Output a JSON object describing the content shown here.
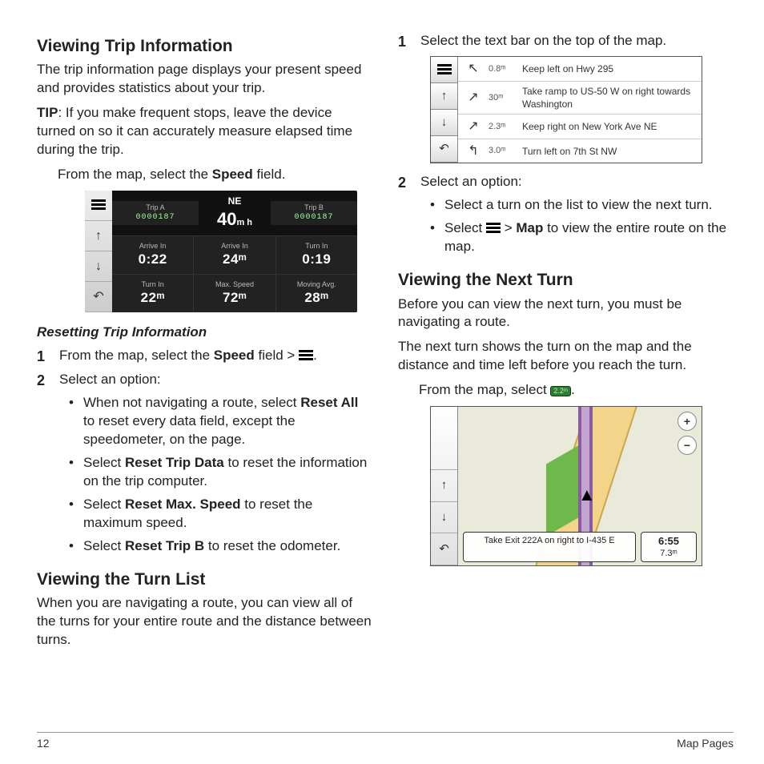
{
  "left": {
    "h1": "Viewing Trip Information",
    "p1": "The trip information page displays your present speed and provides statistics about your trip.",
    "tip_label": "TIP",
    "tip_text": ": If you make frequent stops, leave the device turned on so it can accurately measure elapsed time during the trip.",
    "from_map_pre": "From the map, select the ",
    "speed_word": "Speed",
    "from_map_post": " field.",
    "trip_fig": {
      "direction": "NE",
      "speed": "40",
      "speed_unit": "m h",
      "tripA_lbl": "Trip A",
      "tripA_val": "0000187",
      "tripB_lbl": "Trip B",
      "tripB_val": "0000187",
      "r1": [
        {
          "lbl": "Arrive In",
          "val": "0:22"
        },
        {
          "lbl": "Arrive In",
          "val": "24ᵐ"
        },
        {
          "lbl": "Turn In",
          "val": "0:19"
        }
      ],
      "r2": [
        {
          "lbl": "Turn In",
          "val": "22ᵐ"
        },
        {
          "lbl": "Max. Speed",
          "val": "72ᵐ"
        },
        {
          "lbl": "Moving Avg.",
          "val": "28ᵐ"
        }
      ]
    },
    "h2": "Resetting Trip Information",
    "step1_pre": "From the map, select the ",
    "step1_mid": " field > ",
    "step1_post": ".",
    "step2": "Select an option:",
    "b1_pre": "When not navigating a route, select ",
    "b1_bold": "Reset All",
    "b1_post": " to reset every data field, except the speedometer, on the page.",
    "b2_pre": "Select ",
    "b2_bold": "Reset Trip Data",
    "b2_post": " to reset the information on the trip computer.",
    "b3_pre": "Select ",
    "b3_bold": "Reset Max. Speed",
    "b3_post": " to reset the maximum speed.",
    "b4_pre": "Select ",
    "b4_bold": "Reset Trip B",
    "b4_post": " to reset the odometer.",
    "h3": "Viewing the Turn List",
    "p_turnlist": "When you are navigating a route, you can view all of the turns for your entire route and the distance between turns."
  },
  "right": {
    "step1": "Select the text bar on the top of the map.",
    "turn_fig": {
      "rows": [
        {
          "dist": "0.8ᵐ",
          "text": "Keep left on Hwy 295"
        },
        {
          "dist": "30ᵐ",
          "text": "Take ramp to US-50 W on right towards Washington"
        },
        {
          "dist": "2.3ᵐ",
          "text": "Keep right on New York Ave NE"
        },
        {
          "dist": "3.0ᵐ",
          "text": "Turn left on 7th St NW"
        }
      ]
    },
    "step2": "Select an option:",
    "s2b1": "Select a turn on the list to view the next turn.",
    "s2b2_pre": "Select ",
    "s2b2_mid": " > ",
    "s2b2_bold": "Map",
    "s2b2_post": " to view the entire route on the map.",
    "h2": "Viewing the Next Turn",
    "p1": "Before you can view the next turn, you must be navigating a route.",
    "p2": "The next turn shows the turn on the map and the distance and time left before you reach the turn.",
    "from_map": "From the map, select ",
    "chip": "2.2ᵐ",
    "chip_post": ".",
    "map_fig": {
      "instr": "Take Exit 222A on right to I-435 E",
      "time": "6:55",
      "dist": "7.3ᵐ"
    }
  },
  "footer": {
    "page": "12",
    "title": "Map Pages"
  }
}
